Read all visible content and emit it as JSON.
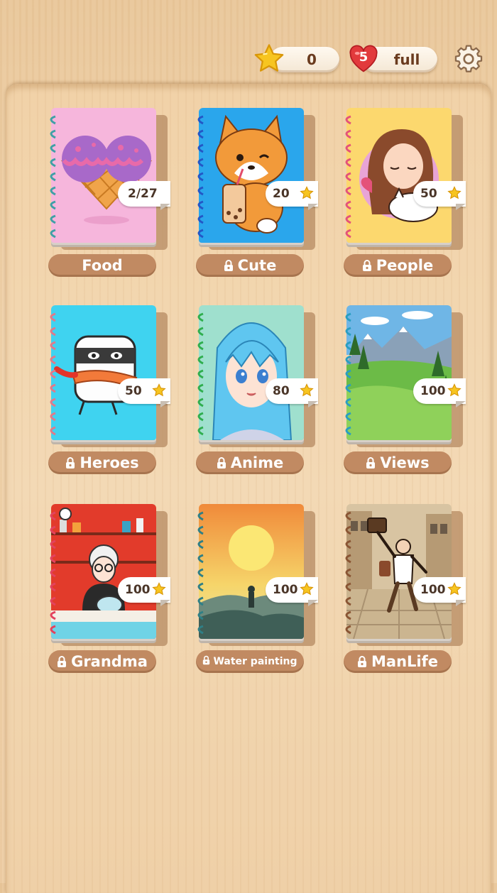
{
  "header": {
    "stars": "0",
    "lives": "5",
    "lives_status": "full",
    "icons": [
      "star-icon",
      "heart-icon",
      "gear-icon"
    ]
  },
  "books": [
    {
      "title": "Food",
      "progress": "2/27",
      "locked": false,
      "cover_color": "#f6b6dc",
      "spiral_color": "#3fa0a6"
    },
    {
      "title": "Cute",
      "cost": "20",
      "locked": true,
      "cover_color": "#2aa6ec",
      "spiral_color": "#2357c6"
    },
    {
      "title": "People",
      "cost": "50",
      "locked": true,
      "cover_color": "#fcd86e",
      "spiral_color": "#e4527a"
    },
    {
      "title": "Heroes",
      "cost": "50",
      "locked": true,
      "cover_color": "#3fd3f0",
      "spiral_color": "#e07a8a"
    },
    {
      "title": "Anime",
      "cost": "80",
      "locked": true,
      "cover_color": "#9fe0ce",
      "spiral_color": "#2fae4e"
    },
    {
      "title": "Views",
      "cost": "100",
      "locked": true,
      "cover_color": "#5aa54a",
      "spiral_color": "#2a9ec2"
    },
    {
      "title": "Grandma",
      "cost": "100",
      "locked": true,
      "cover_color": "#e23b2b",
      "spiral_color": "#e3425e"
    },
    {
      "title": "Water painting",
      "cost": "100",
      "locked": true,
      "cover_color": "#f2b948",
      "spiral_color": "#2f7f86"
    },
    {
      "title": "ManLife",
      "cost": "100",
      "locked": true,
      "cover_color": "#d8c4a2",
      "spiral_color": "#8a5533"
    }
  ]
}
